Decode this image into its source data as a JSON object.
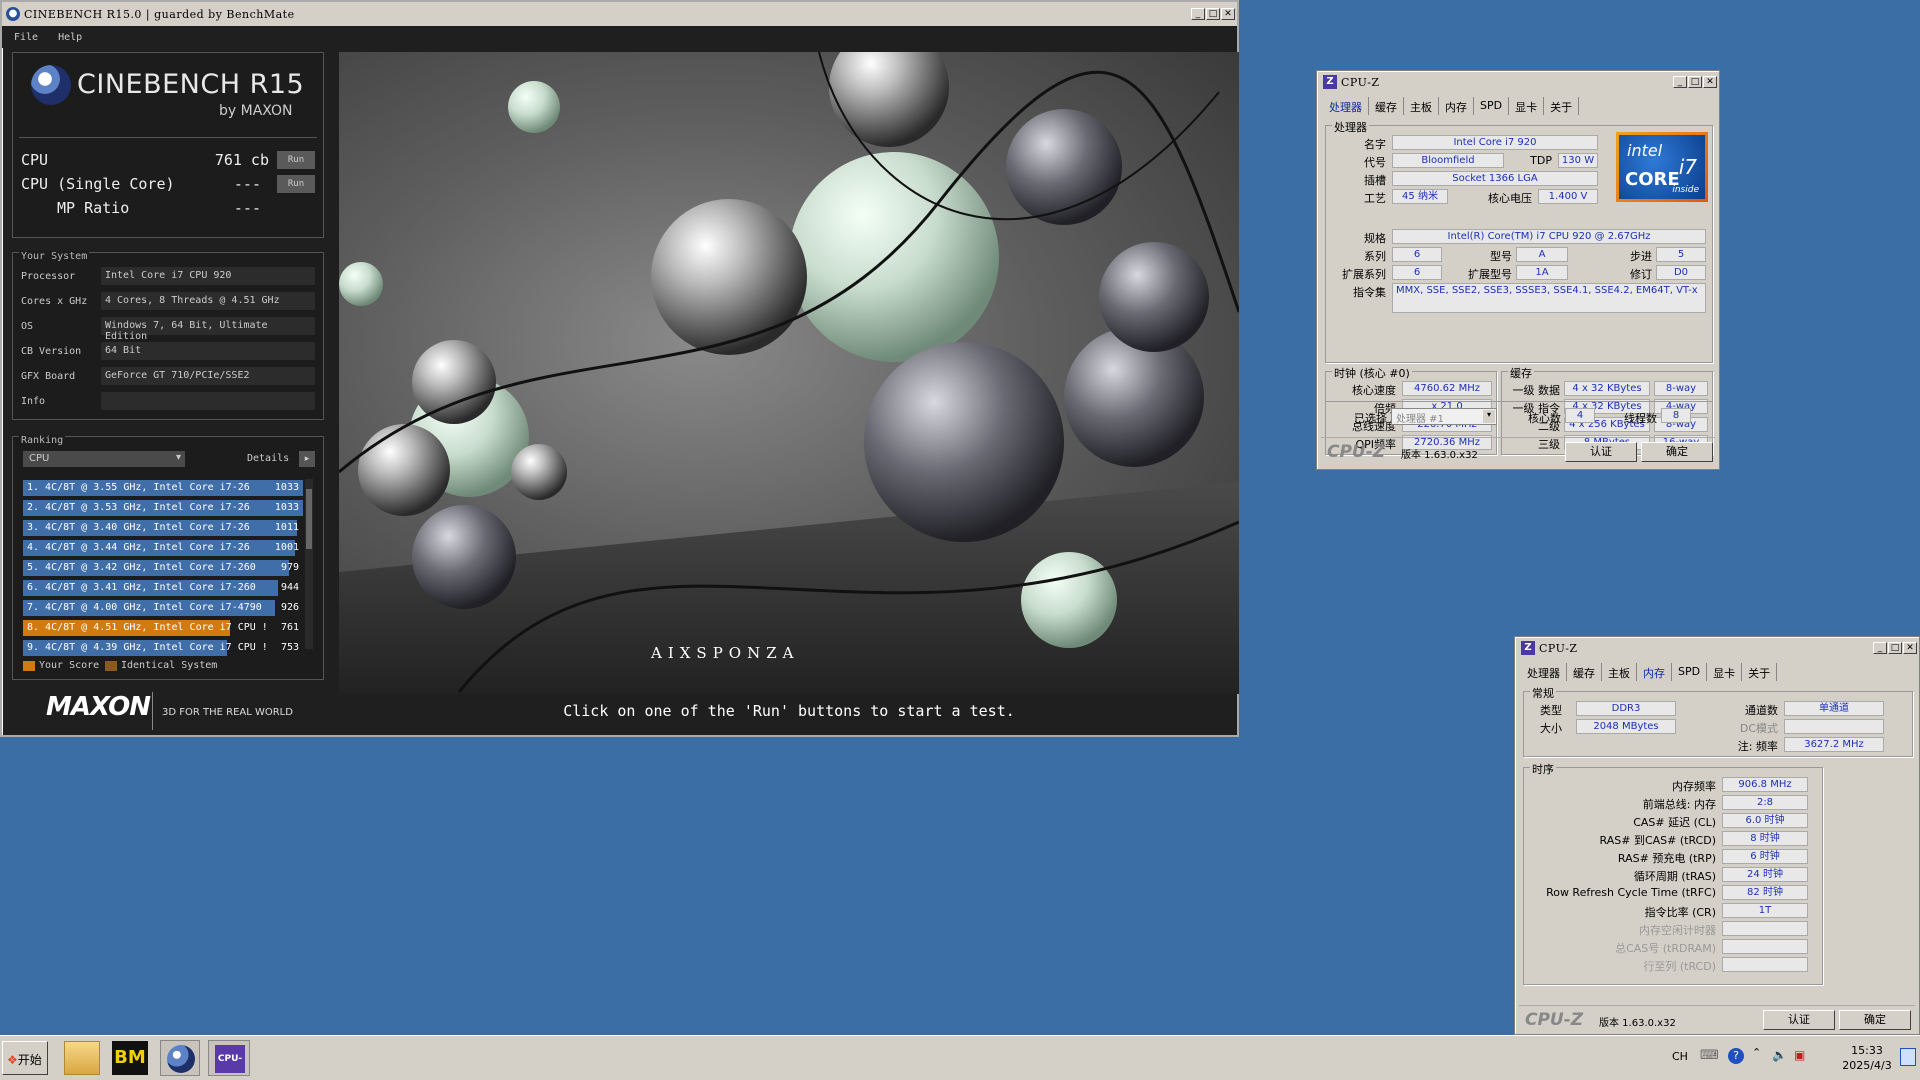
{
  "cinebench": {
    "title": "CINEBENCH R15.0 | guarded by BenchMate",
    "menu": [
      "File",
      "Help"
    ],
    "logo_main": "CINEBENCH R15",
    "logo_sub": "by MAXON",
    "scores": {
      "cpu_label": "CPU",
      "cpu_value": "761 cb",
      "cpu_btn": "Run",
      "single_label": "CPU (Single Core)",
      "single_value": "---",
      "single_btn": "Run",
      "mp_label": "MP Ratio",
      "mp_value": "---"
    },
    "system": {
      "title": "Your System",
      "rows": [
        {
          "k": "Processor",
          "v": "Intel Core i7 CPU 920"
        },
        {
          "k": "Cores x GHz",
          "v": "4 Cores, 8 Threads @ 4.51 GHz"
        },
        {
          "k": "OS",
          "v": "Windows 7, 64 Bit, Ultimate Edition"
        },
        {
          "k": "CB Version",
          "v": "64 Bit"
        },
        {
          "k": "GFX Board",
          "v": "GeForce GT 710/PCIe/SSE2"
        },
        {
          "k": "Info",
          "v": ""
        }
      ]
    },
    "ranking": {
      "title": "Ranking",
      "dropdown": "CPU",
      "details": "Details",
      "rows": [
        {
          "label": "1. 4C/8T @ 3.55 GHz,  Intel Core i7-26",
          "score": "1033",
          "fill": 1.0,
          "mine": false
        },
        {
          "label": "2. 4C/8T @ 3.53 GHz,  Intel Core i7-26",
          "score": "1033",
          "fill": 1.0,
          "mine": false
        },
        {
          "label": "3. 4C/8T @ 3.40 GHz,  Intel Core i7-26",
          "score": "1011",
          "fill": 0.98,
          "mine": false
        },
        {
          "label": "4. 4C/8T @ 3.44 GHz,  Intel Core i7-26",
          "score": "1001",
          "fill": 0.97,
          "mine": false
        },
        {
          "label": "5. 4C/8T @ 3.42 GHz,  Intel Core i7-260",
          "score": "979",
          "fill": 0.95,
          "mine": false
        },
        {
          "label": "6. 4C/8T @ 3.41 GHz,  Intel Core i7-260",
          "score": "944",
          "fill": 0.91,
          "mine": false
        },
        {
          "label": "7. 4C/8T @ 4.00 GHz, Intel Core i7-4790",
          "score": "926",
          "fill": 0.9,
          "mine": false
        },
        {
          "label": "8. 4C/8T @ 4.51 GHz, Intel Core i7 CPU !",
          "score": "761",
          "fill": 0.74,
          "mine": true
        },
        {
          "label": "9. 4C/8T @ 4.39 GHz, Intel Core i7 CPU !",
          "score": "753",
          "fill": 0.73,
          "mine": false
        }
      ],
      "legend_your": "Your Score",
      "legend_ident": "Identical System"
    },
    "footer_logo": "MAXON",
    "footer_tag": "3D FOR THE REAL WORLD",
    "render_logo": "AIXSPONZA",
    "status": "Click on one of the 'Run' buttons to start a test."
  },
  "cpuz1": {
    "title": "CPU-Z",
    "tabs": [
      "处理器",
      "缓存",
      "主板",
      "内存",
      "SPD",
      "显卡",
      "关于"
    ],
    "proc_group": "处理器",
    "name_l": "名字",
    "name": "Intel Core i7 920",
    "code_l": "代号",
    "code": "Bloomfield",
    "tdp_l": "TDP",
    "tdp": "130 W",
    "sock_l": "插槽",
    "sock": "Socket 1366 LGA",
    "tech_l": "工艺",
    "tech": "45 纳米",
    "volt_l": "核心电压",
    "volt": "1.400 V",
    "spec_l": "规格",
    "spec": "Intel(R) Core(TM) i7 CPU      920  @ 2.67GHz",
    "fam_l": "系列",
    "fam": "6",
    "model_l": "型号",
    "model": "A",
    "step_l": "步进",
    "step": "5",
    "xfam_l": "扩展系列",
    "xfam": "6",
    "xmodel_l": "扩展型号",
    "xmodel": "1A",
    "rev_l": "修订",
    "rev": "D0",
    "inst_l": "指令集",
    "inst": "MMX, SSE, SSE2, SSE3, SSSE3, SSE4.1, SSE4.2, EM64T, VT-x",
    "intel_logo": "intel",
    "intel_core": "CORE",
    "intel_i7": "i7",
    "intel_inside": "inside",
    "clock_group": "时钟 (核心 #0)",
    "cs_l": "核心速度",
    "cs": "4760.62 MHz",
    "mul_l": "倍频",
    "mul": "x 21.0",
    "bus_l": "总线速度",
    "bus": "226.70 MHz",
    "qpi_l": "QPI频率",
    "qpi": "2720.36 MHz",
    "cache_group": "缓存",
    "l1d_l": "一级 数据",
    "l1d": "4 x 32 KBytes",
    "l1d_w": "8-way",
    "l1i_l": "一级 指令",
    "l1i": "4 x 32 KBytes",
    "l1i_w": "4-way",
    "l2_l": "二级",
    "l2": "4 x 256 KBytes",
    "l2_w": "8-way",
    "l3_l": "三级",
    "l3": "8 MBytes",
    "l3_w": "16-way",
    "sel_l": "已选择",
    "sel": "处理器 #1",
    "cores_l": "核心数",
    "cores": "4",
    "thr_l": "线程数",
    "thr": "8",
    "logo": "CPU-Z",
    "ver": "版本 1.63.0.x32",
    "btn_validate": "认证",
    "btn_ok": "确定"
  },
  "cpuz2": {
    "title": "CPU-Z",
    "tabs": [
      "处理器",
      "缓存",
      "主板",
      "内存",
      "SPD",
      "显卡",
      "关于"
    ],
    "gen_group": "常规",
    "type_l": "类型",
    "type": "DDR3",
    "chan_l": "通道数",
    "chan": "单通道",
    "size_l": "大小",
    "size": "2048 MBytes",
    "dc_l": "DC模式",
    "dc": "",
    "nb_l": "注: 频率",
    "nb": "3627.2 MHz",
    "tim_group": "时序",
    "timings": [
      {
        "l": "内存频率",
        "v": "906.8 MHz",
        "dim": false
      },
      {
        "l": "前端总线: 内存",
        "v": "2:8",
        "dim": false
      },
      {
        "l": "CAS# 延迟 (CL)",
        "v": "6.0 时钟",
        "dim": false
      },
      {
        "l": "RAS# 到CAS# (tRCD)",
        "v": "8 时钟",
        "dim": false
      },
      {
        "l": "RAS# 预充电 (tRP)",
        "v": "6 时钟",
        "dim": false
      },
      {
        "l": "循环周期 (tRAS)",
        "v": "24 时钟",
        "dim": false
      },
      {
        "l": "Row Refresh Cycle Time (tRFC)",
        "v": "82 时钟",
        "dim": false
      },
      {
        "l": "指令比率 (CR)",
        "v": "1T",
        "dim": false
      },
      {
        "l": "内存空闲计时器",
        "v": "",
        "dim": true
      },
      {
        "l": "总CAS号 (tRDRAM)",
        "v": "",
        "dim": true
      },
      {
        "l": "行至列 (tRCD)",
        "v": "",
        "dim": true
      }
    ],
    "logo": "CPU-Z",
    "ver": "版本 1.63.0.x32",
    "btn_validate": "认证",
    "btn_ok": "确定"
  },
  "taskbar": {
    "start": "开始",
    "tray_lang": "CH",
    "time": "15:33",
    "date": "2025/4/3"
  }
}
